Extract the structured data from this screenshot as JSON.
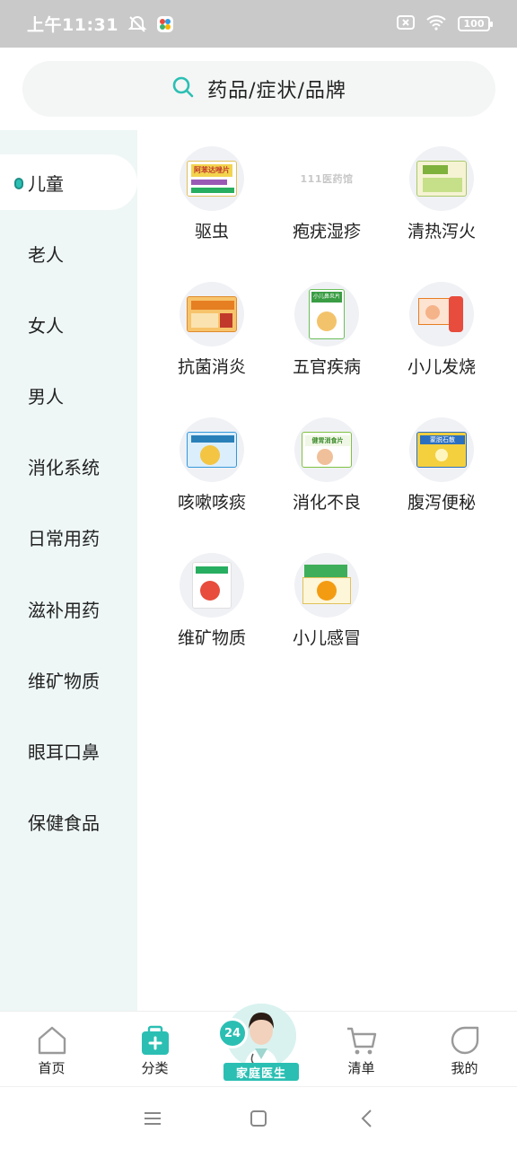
{
  "status_bar": {
    "time": "上午11:31",
    "battery": "100",
    "icons": [
      "alarm-off-icon",
      "app-notification-icon",
      "sim-off-icon",
      "wifi-icon",
      "battery-icon"
    ]
  },
  "search": {
    "placeholder": "药品/症状/品牌",
    "icon": "search-icon"
  },
  "sidebar": {
    "active_index": 0,
    "items": [
      {
        "label": "儿童"
      },
      {
        "label": "老人"
      },
      {
        "label": "女人"
      },
      {
        "label": "男人"
      },
      {
        "label": "消化系统"
      },
      {
        "label": "日常用药"
      },
      {
        "label": "滋补用药"
      },
      {
        "label": "维矿物质"
      },
      {
        "label": "眼耳口鼻"
      },
      {
        "label": "保健食品"
      }
    ]
  },
  "categories": [
    {
      "label": "驱虫",
      "box_label": "阿苯达唑片"
    },
    {
      "label": "疱疣湿疹",
      "box_label": "111医药馆"
    },
    {
      "label": "清热泻火",
      "box_label": ""
    },
    {
      "label": "抗菌消炎",
      "box_label": ""
    },
    {
      "label": "五官疾病",
      "box_label": "小儿鼻炎片"
    },
    {
      "label": "小儿发烧",
      "box_label": ""
    },
    {
      "label": "咳嗽咳痰",
      "box_label": ""
    },
    {
      "label": "消化不良",
      "box_label": "健胃消食片"
    },
    {
      "label": "腹泻便秘",
      "box_label": "蒙脱石散"
    },
    {
      "label": "维矿物质",
      "box_label": ""
    },
    {
      "label": "小儿感冒",
      "box_label": ""
    }
  ],
  "tabbar": {
    "tabs": [
      {
        "label": "首页",
        "icon": "home-icon"
      },
      {
        "label": "分类",
        "icon": "category-icon"
      },
      {
        "label": "清单",
        "icon": "cart-icon"
      },
      {
        "label": "我的",
        "icon": "profile-icon"
      }
    ],
    "active_index": 1,
    "doctor": {
      "badge": "24",
      "label": "家庭医生"
    }
  },
  "colors": {
    "accent": "#2bbfb3",
    "sidebar_bg": "#eef7f6",
    "status_bar_bg": "#c9c9c9"
  }
}
